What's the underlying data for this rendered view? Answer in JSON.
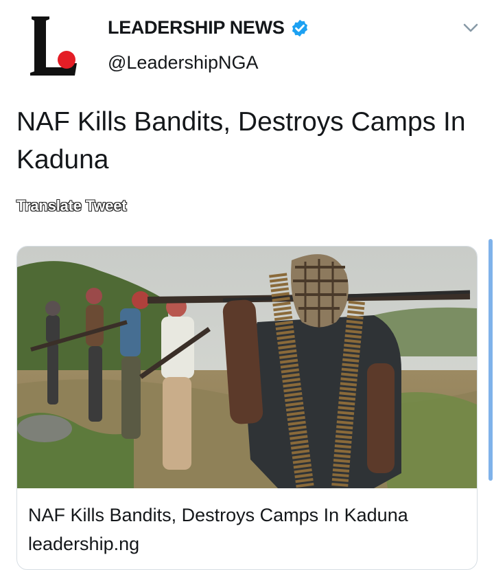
{
  "author": {
    "name": "LEADERSHIP NEWS",
    "handle": "@LeadershipNGA",
    "avatar_icon": "leadership-logo",
    "verified_icon": "verified-badge-icon"
  },
  "menu_icon": "chevron-down-icon",
  "tweet": {
    "text": "NAF Kills Bandits, Destroys Camps In Kaduna",
    "translate_label": "Translate Tweet"
  },
  "link_card": {
    "title": "NAF Kills Bandits, Destroys Camps In Kaduna",
    "domain": "leadership.ng",
    "image_icon": "armed-men-photo"
  },
  "colors": {
    "verified": "#1da1f2",
    "logo_dot": "#e41e26",
    "text": "#14171a",
    "card_border": "#d6dde3"
  }
}
